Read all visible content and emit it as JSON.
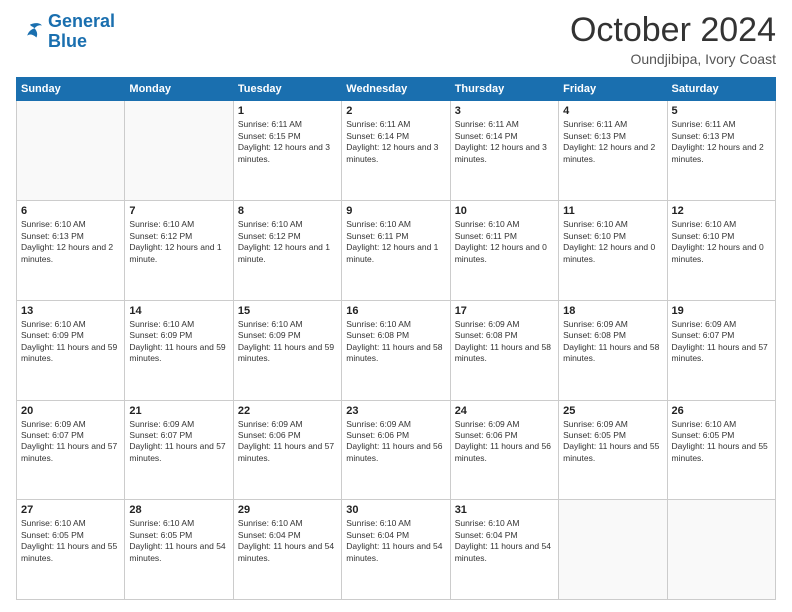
{
  "logo": {
    "line1": "General",
    "line2": "Blue"
  },
  "header": {
    "month": "October 2024",
    "location": "Oundjibipa, Ivory Coast"
  },
  "weekdays": [
    "Sunday",
    "Monday",
    "Tuesday",
    "Wednesday",
    "Thursday",
    "Friday",
    "Saturday"
  ],
  "weeks": [
    [
      {
        "day": "",
        "text": ""
      },
      {
        "day": "",
        "text": ""
      },
      {
        "day": "1",
        "text": "Sunrise: 6:11 AM\nSunset: 6:15 PM\nDaylight: 12 hours and 3 minutes."
      },
      {
        "day": "2",
        "text": "Sunrise: 6:11 AM\nSunset: 6:14 PM\nDaylight: 12 hours and 3 minutes."
      },
      {
        "day": "3",
        "text": "Sunrise: 6:11 AM\nSunset: 6:14 PM\nDaylight: 12 hours and 3 minutes."
      },
      {
        "day": "4",
        "text": "Sunrise: 6:11 AM\nSunset: 6:13 PM\nDaylight: 12 hours and 2 minutes."
      },
      {
        "day": "5",
        "text": "Sunrise: 6:11 AM\nSunset: 6:13 PM\nDaylight: 12 hours and 2 minutes."
      }
    ],
    [
      {
        "day": "6",
        "text": "Sunrise: 6:10 AM\nSunset: 6:13 PM\nDaylight: 12 hours and 2 minutes."
      },
      {
        "day": "7",
        "text": "Sunrise: 6:10 AM\nSunset: 6:12 PM\nDaylight: 12 hours and 1 minute."
      },
      {
        "day": "8",
        "text": "Sunrise: 6:10 AM\nSunset: 6:12 PM\nDaylight: 12 hours and 1 minute."
      },
      {
        "day": "9",
        "text": "Sunrise: 6:10 AM\nSunset: 6:11 PM\nDaylight: 12 hours and 1 minute."
      },
      {
        "day": "10",
        "text": "Sunrise: 6:10 AM\nSunset: 6:11 PM\nDaylight: 12 hours and 0 minutes."
      },
      {
        "day": "11",
        "text": "Sunrise: 6:10 AM\nSunset: 6:10 PM\nDaylight: 12 hours and 0 minutes."
      },
      {
        "day": "12",
        "text": "Sunrise: 6:10 AM\nSunset: 6:10 PM\nDaylight: 12 hours and 0 minutes."
      }
    ],
    [
      {
        "day": "13",
        "text": "Sunrise: 6:10 AM\nSunset: 6:09 PM\nDaylight: 11 hours and 59 minutes."
      },
      {
        "day": "14",
        "text": "Sunrise: 6:10 AM\nSunset: 6:09 PM\nDaylight: 11 hours and 59 minutes."
      },
      {
        "day": "15",
        "text": "Sunrise: 6:10 AM\nSunset: 6:09 PM\nDaylight: 11 hours and 59 minutes."
      },
      {
        "day": "16",
        "text": "Sunrise: 6:10 AM\nSunset: 6:08 PM\nDaylight: 11 hours and 58 minutes."
      },
      {
        "day": "17",
        "text": "Sunrise: 6:09 AM\nSunset: 6:08 PM\nDaylight: 11 hours and 58 minutes."
      },
      {
        "day": "18",
        "text": "Sunrise: 6:09 AM\nSunset: 6:08 PM\nDaylight: 11 hours and 58 minutes."
      },
      {
        "day": "19",
        "text": "Sunrise: 6:09 AM\nSunset: 6:07 PM\nDaylight: 11 hours and 57 minutes."
      }
    ],
    [
      {
        "day": "20",
        "text": "Sunrise: 6:09 AM\nSunset: 6:07 PM\nDaylight: 11 hours and 57 minutes."
      },
      {
        "day": "21",
        "text": "Sunrise: 6:09 AM\nSunset: 6:07 PM\nDaylight: 11 hours and 57 minutes."
      },
      {
        "day": "22",
        "text": "Sunrise: 6:09 AM\nSunset: 6:06 PM\nDaylight: 11 hours and 57 minutes."
      },
      {
        "day": "23",
        "text": "Sunrise: 6:09 AM\nSunset: 6:06 PM\nDaylight: 11 hours and 56 minutes."
      },
      {
        "day": "24",
        "text": "Sunrise: 6:09 AM\nSunset: 6:06 PM\nDaylight: 11 hours and 56 minutes."
      },
      {
        "day": "25",
        "text": "Sunrise: 6:09 AM\nSunset: 6:05 PM\nDaylight: 11 hours and 55 minutes."
      },
      {
        "day": "26",
        "text": "Sunrise: 6:10 AM\nSunset: 6:05 PM\nDaylight: 11 hours and 55 minutes."
      }
    ],
    [
      {
        "day": "27",
        "text": "Sunrise: 6:10 AM\nSunset: 6:05 PM\nDaylight: 11 hours and 55 minutes."
      },
      {
        "day": "28",
        "text": "Sunrise: 6:10 AM\nSunset: 6:05 PM\nDaylight: 11 hours and 54 minutes."
      },
      {
        "day": "29",
        "text": "Sunrise: 6:10 AM\nSunset: 6:04 PM\nDaylight: 11 hours and 54 minutes."
      },
      {
        "day": "30",
        "text": "Sunrise: 6:10 AM\nSunset: 6:04 PM\nDaylight: 11 hours and 54 minutes."
      },
      {
        "day": "31",
        "text": "Sunrise: 6:10 AM\nSunset: 6:04 PM\nDaylight: 11 hours and 54 minutes."
      },
      {
        "day": "",
        "text": ""
      },
      {
        "day": "",
        "text": ""
      }
    ]
  ]
}
